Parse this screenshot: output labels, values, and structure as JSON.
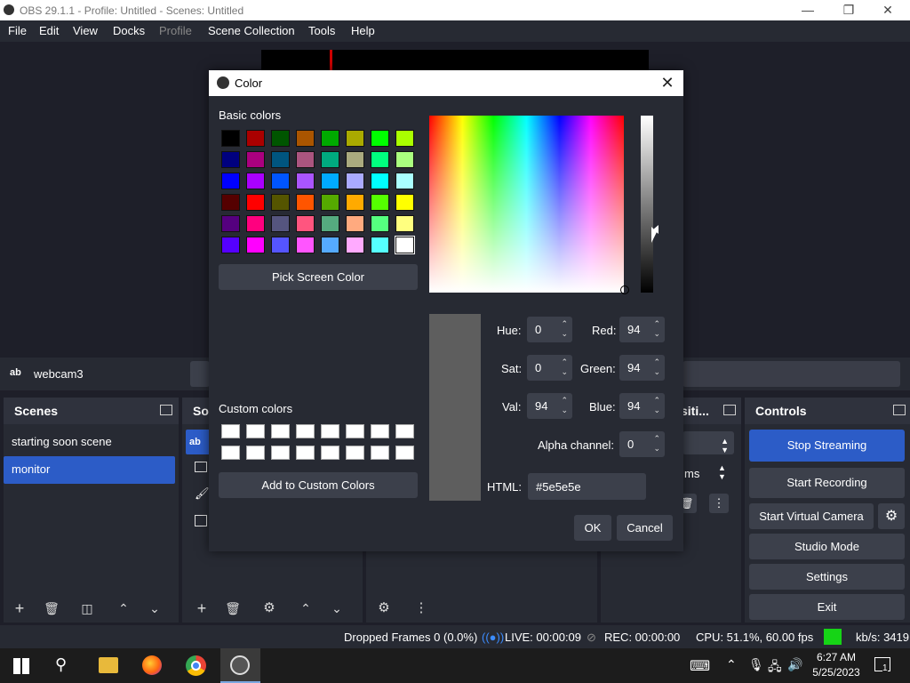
{
  "window": {
    "title": "OBS 29.1.1 - Profile: Untitled - Scenes: Untitled",
    "minimize_icon": "minimize-icon",
    "maximize_icon": "restore-icon",
    "close_icon": "close-icon"
  },
  "menu": [
    "File",
    "Edit",
    "View",
    "Docks",
    "Profile",
    "Scene Collection",
    "Tools",
    "Help"
  ],
  "source_bar": {
    "source_name": "webcam3"
  },
  "scenes_dock": {
    "title": "Scenes",
    "items": [
      "starting soon scene",
      "monitor"
    ],
    "selected_index": 1
  },
  "sources_dock": {
    "title": "So"
  },
  "transitions_dock": {
    "title": "siti...",
    "duration_label": "ms"
  },
  "controls_dock": {
    "title": "Controls",
    "buttons": [
      "Stop Streaming",
      "Start Recording",
      "Start Virtual Camera",
      "Studio Mode",
      "Settings",
      "Exit"
    ]
  },
  "status_bar": {
    "dropped_frames": "Dropped Frames 0 (0.0%)",
    "live": "LIVE: 00:00:09",
    "rec": "REC: 00:00:00",
    "cpu": "CPU: 51.1%, 60.00 fps",
    "kbs": "kb/s: 3419"
  },
  "taskbar": {
    "time": "6:27 AM",
    "date": "5/25/2023",
    "notification_count": "1"
  },
  "color_dialog": {
    "title": "Color",
    "basic_colors_label": "Basic colors",
    "basic_colors": [
      [
        "#000000",
        "#aa0000",
        "#005500",
        "#aa5500",
        "#00aa00",
        "#aaaa00",
        "#00ff00",
        "#aaff00"
      ],
      [
        "#00007f",
        "#aa007f",
        "#00557f",
        "#aa557f",
        "#00aa7f",
        "#aaaa7f",
        "#00ff7f",
        "#aaff7f"
      ],
      [
        "#0000ff",
        "#aa00ff",
        "#0055ff",
        "#aa55ff",
        "#00aaff",
        "#aaaaff",
        "#00ffff",
        "#aaffff"
      ],
      [
        "#550000",
        "#ff0000",
        "#555500",
        "#ff5500",
        "#55aa00",
        "#ffaa00",
        "#55ff00",
        "#ffff00"
      ],
      [
        "#55007f",
        "#ff007f",
        "#55557f",
        "#ff557f",
        "#55aa7f",
        "#ffaa7f",
        "#55ff7f",
        "#ffff7f"
      ],
      [
        "#5500ff",
        "#ff00ff",
        "#5555ff",
        "#ff55ff",
        "#55aaff",
        "#ffaaff",
        "#55ffff",
        "#ffffff"
      ]
    ],
    "pick_screen_color": "Pick Screen Color",
    "custom_colors_label": "Custom colors",
    "add_custom": "Add to Custom Colors",
    "hue_label": "Hue:",
    "hue": "0",
    "sat_label": "Sat:",
    "sat": "0",
    "val_label": "Val:",
    "val": "94",
    "red_label": "Red:",
    "red": "94",
    "green_label": "Green:",
    "green": "94",
    "blue_label": "Blue:",
    "blue": "94",
    "alpha_label": "Alpha channel:",
    "alpha": "0",
    "html_label": "HTML:",
    "html": "#5e5e5e",
    "ok": "OK",
    "cancel": "Cancel",
    "current_color": "#5e5e5e"
  }
}
